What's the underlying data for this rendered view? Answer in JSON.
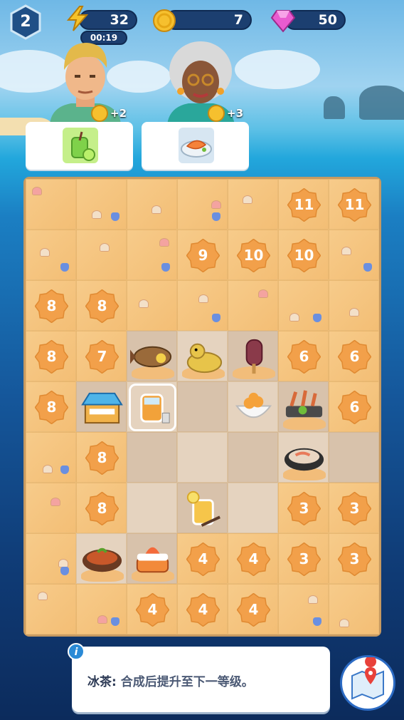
{
  "level": "2",
  "resources": {
    "energy": "32",
    "energy_timer": "00:19",
    "coins": "7",
    "gems": "50"
  },
  "customers": [
    {
      "reward": "+2",
      "order": "green-juice"
    },
    {
      "reward": "+3",
      "order": "salmon-plate"
    }
  ],
  "board": {
    "locks": {
      "r0c5": "11",
      "r0c6": "11",
      "r1c3": "9",
      "r1c4": "10",
      "r1c5": "10",
      "r2c0": "8",
      "r2c1": "8",
      "r3c0": "8",
      "r3c1": "7",
      "r3c5": "6",
      "r3c6": "6",
      "r4c0": "8",
      "r4c6": "6",
      "r5c1": "8",
      "r6c1": "8",
      "r6c5": "3",
      "r6c6": "3",
      "r7c3": "4",
      "r7c4": "4",
      "r7c5": "3",
      "r7c6": "3",
      "r8c2": "4",
      "r8c3": "4",
      "r8c4": "4"
    }
  },
  "info": {
    "item_name": "冰茶:",
    "description": "合成后提升至下一等级。"
  },
  "colors": {
    "lock_badge": "#f2a04a",
    "board_frame": "#c79a61",
    "accent": "#2a8ad6"
  }
}
